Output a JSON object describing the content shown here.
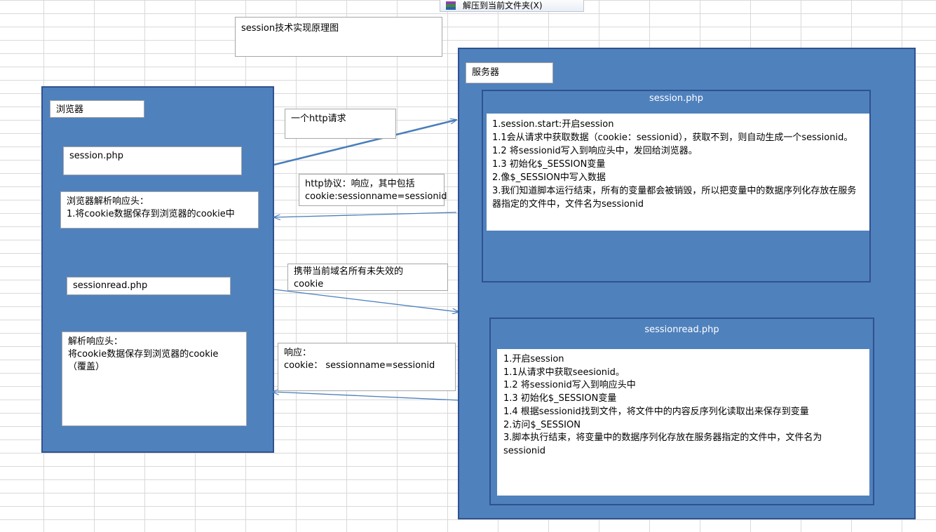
{
  "menu_tooltip": {
    "icon": "winrar-archive-icon",
    "label": "解压到当前文件夹(X)"
  },
  "title": "session技术实现原理图",
  "browser": {
    "label": "浏览器",
    "session_php": "session.php",
    "parse_box": "浏览器解析响应头：\n1.将cookie数据保存到浏览器的cookie中",
    "sessionread_php": "sessionread.php",
    "parse_box2": "解析响应头：\n将cookie数据保存到浏览器的cookie\n（覆盖）"
  },
  "arrows": {
    "http_request": "一个http请求",
    "http_response": "http协议：响应，其中包括\ncookie:sessionname=sessionid",
    "carry_cookie": "携带当前域名所有未失效的\ncookie",
    "response2": "响应：\ncookie： sessionname=sessionid"
  },
  "server": {
    "label": "服务器",
    "session_php": {
      "title": "session.php",
      "body": "1.session.start:开启session\n1.1会从请求中获取数据（cookie：sessionid），获取不到，则自动生成一个sessionid。\n1.2 将sessionid写入到响应头中，发回给浏览器。\n1.3 初始化$_SESSION变量\n2.像$_SESSION中写入数据\n3.我们知道脚本运行结束，所有的变量都会被销毁，所以把变量中的数据序列化存放在服务器指定的文件中，文件名为sessionid"
    },
    "sessionread_php": {
      "title": "sessionread.php",
      "body": "1.开启session\n1.1从请求中获取seesionid。\n1.2 将sessionid写入到响应头中\n1.3 初始化$_SESSION变量\n1.4 根据sessionid找到文件，将文件中的内容反序列化读取出来保存到变量\n2.访问$_SESSION\n3.脚本执行结束，将变量中的数据序列化存放在服务器指定的文件中，文件名为sessionid"
    }
  },
  "colors": {
    "box_fill": "#4f81bd",
    "box_border": "#2f528f",
    "arrow": "#4a7ebb"
  }
}
